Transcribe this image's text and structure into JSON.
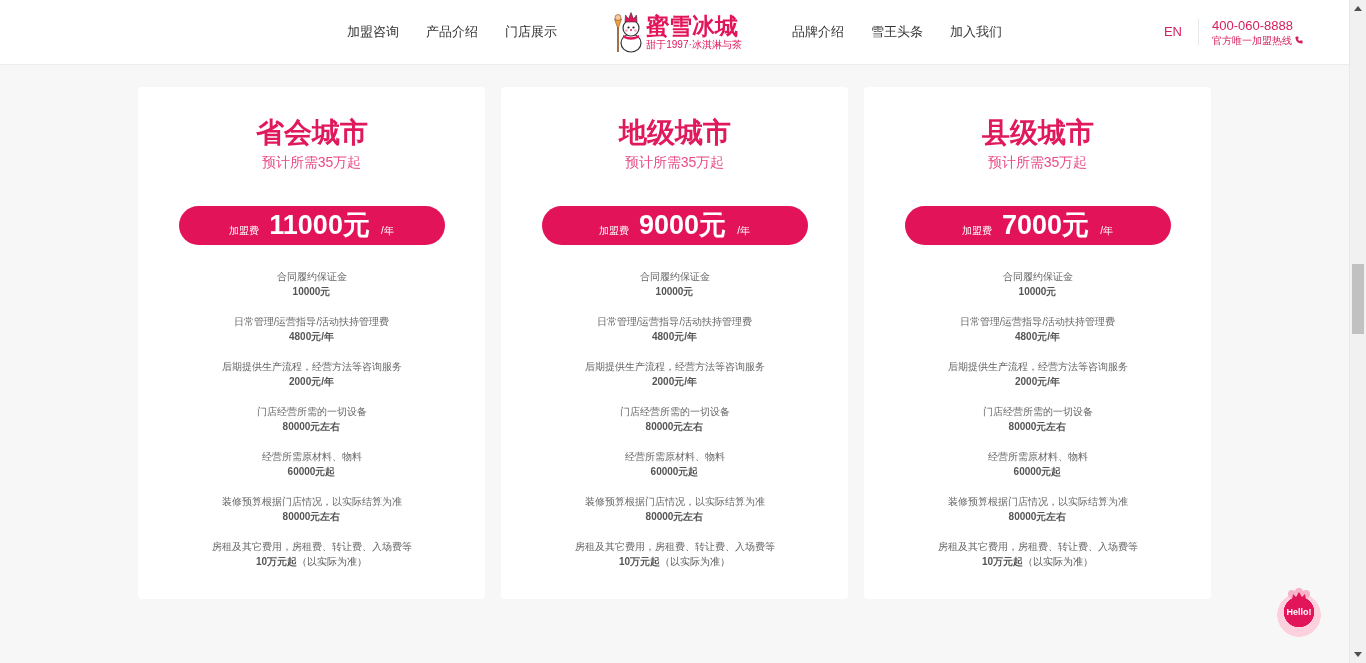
{
  "header": {
    "nav_left": [
      "加盟咨询",
      "产品介绍",
      "门店展示"
    ],
    "logo": {
      "name": "蜜雪冰城",
      "tagline": "甜于1997·冰淇淋与茶"
    },
    "nav_right": [
      "品牌介绍",
      "雪王头条",
      "加入我们"
    ],
    "language": {
      "label": "EN",
      "highlighted": true
    },
    "hotline": {
      "number": "400-060-8888",
      "caption": "官方唯一加盟热线"
    }
  },
  "plans": [
    {
      "title": "省会城市",
      "subtitle": "预计所需35万起",
      "fee": {
        "label": "加盟费",
        "amount": "11000元",
        "unit": "/年"
      },
      "items": [
        {
          "label": "合同履约保证金",
          "value": "10000元"
        },
        {
          "label": "日常管理/运营指导/活动扶持管理费",
          "value": "4800元/年"
        },
        {
          "label": "后期提供生产流程，经营方法等咨询服务",
          "value": "2000元/年"
        },
        {
          "label": "门店经营所需的一切设备",
          "value": "80000元左右"
        },
        {
          "label": "经营所需原材料、物料",
          "value": "60000元起"
        },
        {
          "label": "装修预算根据门店情况，以实际结算为准",
          "value": "80000元左右"
        },
        {
          "label": "房租及其它费用，房租费、转让费、入场费等",
          "value": "**10万元起**（以实际为准）"
        }
      ]
    },
    {
      "title": "地级城市",
      "subtitle": "预计所需35万起",
      "fee": {
        "label": "加盟费",
        "amount": "9000元",
        "unit": "/年"
      },
      "items": [
        {
          "label": "合同履约保证金",
          "value": "10000元"
        },
        {
          "label": "日常管理/运营指导/活动扶持管理费",
          "value": "4800元/年"
        },
        {
          "label": "后期提供生产流程，经营方法等咨询服务",
          "value": "2000元/年"
        },
        {
          "label": "门店经营所需的一切设备",
          "value": "80000元左右"
        },
        {
          "label": "经营所需原材料、物料",
          "value": "60000元起"
        },
        {
          "label": "装修预算根据门店情况，以实际结算为准",
          "value": "80000元左右"
        },
        {
          "label": "房租及其它费用，房租费、转让费、入场费等",
          "value": "**10万元起**（以实际为准）"
        }
      ]
    },
    {
      "title": "县级城市",
      "subtitle": "预计所需35万起",
      "fee": {
        "label": "加盟费",
        "amount": "7000元",
        "unit": "/年"
      },
      "items": [
        {
          "label": "合同履约保证金",
          "value": "10000元"
        },
        {
          "label": "日常管理/运营指导/活动扶持管理费",
          "value": "4800元/年"
        },
        {
          "label": "后期提供生产流程，经营方法等咨询服务",
          "value": "2000元/年"
        },
        {
          "label": "门店经营所需的一切设备",
          "value": "80000元左右"
        },
        {
          "label": "经营所需原材料、物料",
          "value": "60000元起"
        },
        {
          "label": "装修预算根据门店情况，以实际结算为准",
          "value": "80000元左右"
        },
        {
          "label": "房租及其它费用，房租费、转让费、入场费等",
          "value": "**10万元起**（以实际为准）"
        }
      ]
    }
  ],
  "chat_widget": {
    "label": "Hello!"
  }
}
